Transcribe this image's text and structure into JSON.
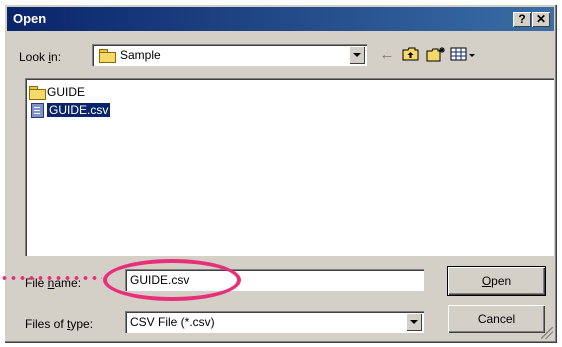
{
  "window": {
    "title": "Open",
    "help_label": "?",
    "close_label": "✕"
  },
  "lookin": {
    "label_prefix": "Look ",
    "label_accel": "i",
    "label_suffix": "n:",
    "value": "Sample"
  },
  "toolbar": {
    "back_icon": "←",
    "up_icon": "up-folder-icon",
    "newfolder_icon": "new-folder-icon",
    "views_icon": "views-menu-icon"
  },
  "files": [
    {
      "name": "GUIDE",
      "type": "folder",
      "selected": false
    },
    {
      "name": "GUIDE.csv",
      "type": "csv",
      "selected": true
    }
  ],
  "filename": {
    "label_prefix": "File ",
    "label_accel": "n",
    "label_suffix": "ame:",
    "value": "GUIDE.csv"
  },
  "filetype": {
    "label_prefix": "Files of ",
    "label_accel": "t",
    "label_suffix": "ype:",
    "value": "CSV File (*.csv)"
  },
  "buttons": {
    "open_accel": "O",
    "open_rest": "pen",
    "cancel": "Cancel"
  },
  "colors": {
    "titlebar_start": "#0a246a",
    "titlebar_end": "#3a6ea5",
    "highlight": "#e8307a",
    "selection": "#0a246a"
  }
}
